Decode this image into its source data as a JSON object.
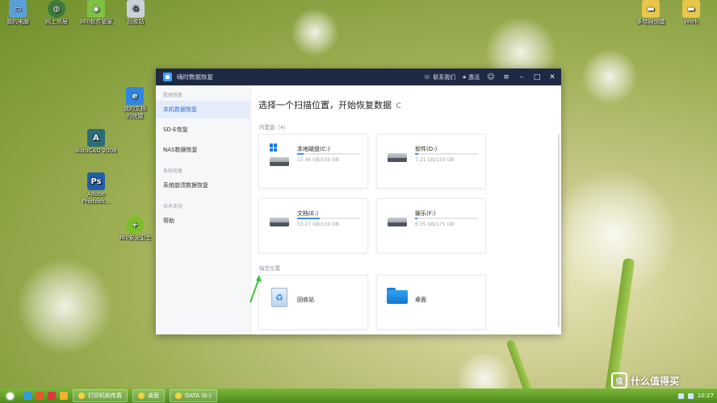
{
  "desktop": {
    "icons": [
      {
        "label": "我的电脑",
        "glyph": "my-computer-icon",
        "color": "#5aa0d8"
      },
      {
        "label": "网上邻居",
        "glyph": "network-icon",
        "color": "#3a7a3a"
      },
      {
        "label": "360软件管家",
        "glyph": "app-store-icon",
        "color": "#7dc242"
      },
      {
        "label": "回收站",
        "glyph": "recycle-bin-icon",
        "color": "#c9d2dc"
      },
      {
        "label": "我的文档\n的快捷",
        "glyph": "documents-icon",
        "color": "#2f86e0"
      },
      {
        "label": "AutoCAD 2008",
        "glyph": "autocad-icon",
        "color": "#2e6d78"
      },
      {
        "label": "Adobe\nPhotosh...",
        "glyph": "photoshop-icon",
        "color": "#1f5fa8"
      },
      {
        "label": "360安全卫士",
        "glyph": "security-icon",
        "color": "#7bbf2a"
      },
      {
        "label": "多特网快捷",
        "glyph": "folder-icon",
        "color": "#e8c64a"
      },
      {
        "label": "Work",
        "glyph": "folder-icon",
        "color": "#e8c64a"
      }
    ]
  },
  "app": {
    "title": "嗨时数据恢复",
    "contact_label": "联系我们",
    "unlock_label": "激活",
    "accent": "#2f6fe0",
    "sidebar": {
      "sections": [
        {
          "title": "数据恢复",
          "items": [
            "本机数据恢复",
            "SD卡恢复",
            "NAS数据恢复"
          ]
        },
        {
          "title": "系统恢复",
          "items": [
            "系统崩溃数据恢复"
          ]
        },
        {
          "title": "技术支持",
          "items": [
            "帮助"
          ]
        }
      ]
    },
    "main": {
      "heading": "选择一个扫描位置，开始恢复数据",
      "refresh_glyph": "C",
      "internal_label": "内置盘（4）",
      "drives": [
        {
          "name": "本地磁盘(C:)",
          "size": "15.46 GB/150 GB",
          "used": 0.1,
          "system": true
        },
        {
          "name": "软件(D:)",
          "size": "7.21 GB/150 GB",
          "used": 0.05,
          "system": false
        },
        {
          "name": "文档(E:)",
          "size": "53.27 GB/150 GB",
          "used": 0.36,
          "system": false
        },
        {
          "name": "娱乐(F:)",
          "size": "6.55 GB/175 GB",
          "used": 0.04,
          "system": false
        }
      ],
      "location_label": "指定位置",
      "locations": [
        {
          "name": "回收站",
          "icon": "recycle-bin-icon"
        },
        {
          "name": "桌面",
          "icon": "desktop-folder-icon"
        }
      ]
    }
  },
  "taskbar": {
    "tasks": [
      "打印机和传真",
      "桌面",
      "DATA (E:)"
    ],
    "clock": "10:27"
  },
  "watermark": "什么值得买"
}
